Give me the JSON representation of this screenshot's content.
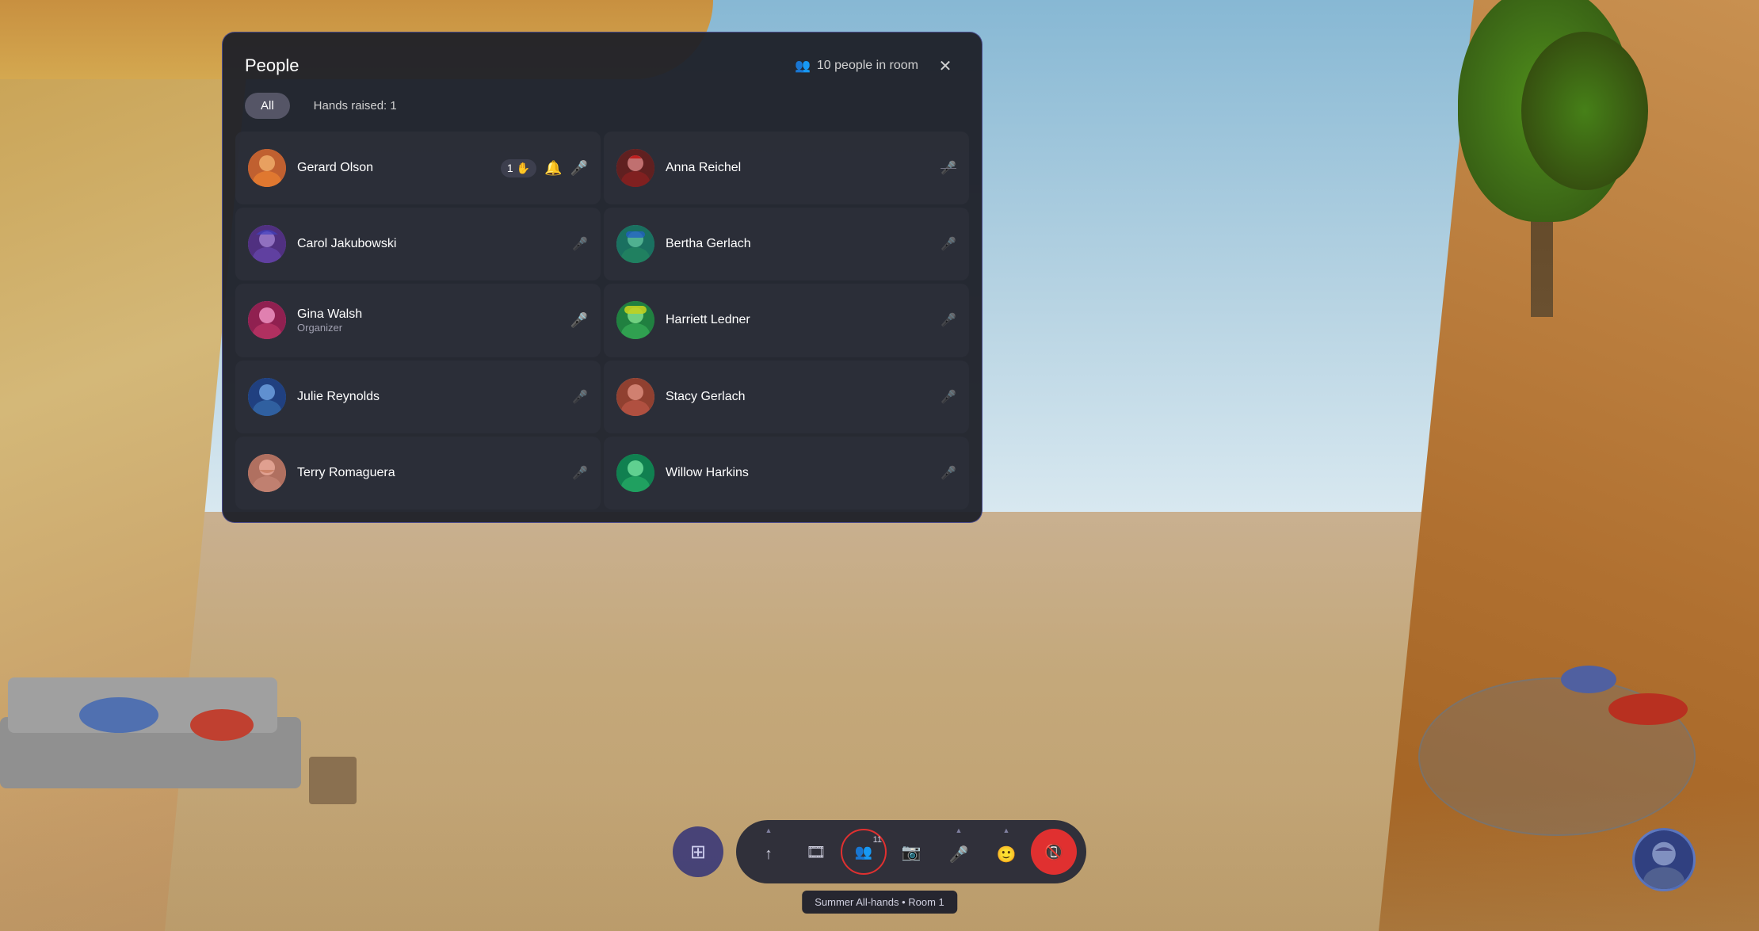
{
  "background": {
    "description": "Virtual meeting room with sandy/wooden curved walls, tree, and furniture"
  },
  "panel": {
    "title": "People",
    "people_count": "10 people in room",
    "tab_all": "All",
    "tab_hands": "Hands raised: 1",
    "participants": [
      {
        "id": 1,
        "name": "Gerard Olson",
        "role": "",
        "hand_count": "1",
        "has_hand": true,
        "has_notification": true,
        "mic_active": true,
        "mic_muted": false,
        "avatar_color": "av-orange",
        "avatar_emoji": "🧑"
      },
      {
        "id": 2,
        "name": "Anna Reichel",
        "role": "",
        "has_hand": false,
        "mic_active": false,
        "mic_muted": true,
        "avatar_color": "av-red",
        "avatar_emoji": "👩"
      },
      {
        "id": 3,
        "name": "Carol Jakubowski",
        "role": "",
        "has_hand": false,
        "mic_active": false,
        "mic_muted": true,
        "avatar_color": "av-purple",
        "avatar_emoji": "🧕"
      },
      {
        "id": 4,
        "name": "Bertha Gerlach",
        "role": "",
        "has_hand": false,
        "mic_active": false,
        "mic_muted": true,
        "avatar_color": "av-teal",
        "avatar_emoji": "👩"
      },
      {
        "id": 5,
        "name": "Gina Walsh",
        "role": "Organizer",
        "has_hand": false,
        "mic_active": true,
        "mic_muted": false,
        "avatar_color": "av-pink",
        "avatar_emoji": "👩"
      },
      {
        "id": 6,
        "name": "Harriett Ledner",
        "role": "",
        "has_hand": false,
        "mic_active": false,
        "mic_muted": true,
        "avatar_color": "av-green",
        "avatar_emoji": "👩"
      },
      {
        "id": 7,
        "name": "Julie Reynolds",
        "role": "",
        "has_hand": false,
        "mic_active": false,
        "mic_muted": true,
        "avatar_color": "av-blue",
        "avatar_emoji": "👩"
      },
      {
        "id": 8,
        "name": "Stacy Gerlach",
        "role": "",
        "has_hand": false,
        "mic_active": false,
        "mic_muted": true,
        "avatar_color": "av-salmon",
        "avatar_emoji": "👩"
      },
      {
        "id": 9,
        "name": "Terry Romaguera",
        "role": "",
        "has_hand": false,
        "mic_active": false,
        "mic_muted": true,
        "avatar_color": "av-salmon",
        "avatar_emoji": "🧔"
      },
      {
        "id": 10,
        "name": "Willow Harkins",
        "role": "",
        "has_hand": false,
        "mic_active": false,
        "mic_muted": true,
        "avatar_color": "av-green2",
        "avatar_emoji": "👩"
      }
    ]
  },
  "toolbar": {
    "grid_icon": "⊞",
    "share_label": "↑",
    "filmstrip_label": "🎬",
    "people_label": "👥",
    "people_count": "11",
    "camera_label": "📷",
    "mic_label": "🎤",
    "emoji_label": "🙂",
    "end_label": "☎",
    "tooltip": "Summer All-hands • Room 1"
  },
  "bottom_avatar": {
    "emoji": "👩"
  }
}
